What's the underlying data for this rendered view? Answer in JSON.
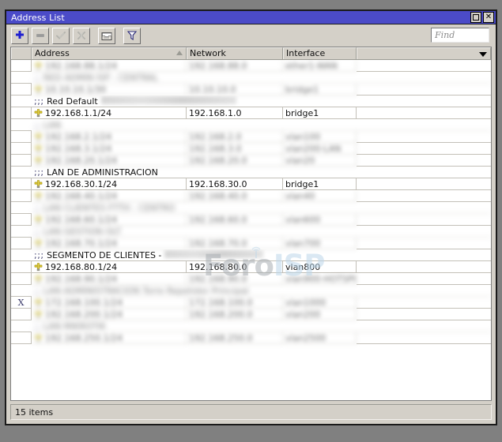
{
  "window": {
    "title": "Address List",
    "maximize_label": "□",
    "close_label": "✕"
  },
  "toolbar": {
    "buttons": [
      {
        "name": "add-button",
        "icon": "plus-icon",
        "enabled": true,
        "label": "+"
      },
      {
        "name": "remove-button",
        "icon": "minus-icon",
        "enabled": false,
        "label": "−"
      },
      {
        "name": "enable-button",
        "icon": "check-icon",
        "enabled": false,
        "label": "✓"
      },
      {
        "name": "disable-button",
        "icon": "cross-icon",
        "enabled": false,
        "label": "✗"
      },
      {
        "name": "comment-button",
        "icon": "comment-icon",
        "enabled": true,
        "label": ""
      },
      {
        "name": "filter-button",
        "icon": "funnel-icon",
        "enabled": true,
        "label": ""
      }
    ],
    "find": {
      "placeholder": "Find",
      "value": ""
    }
  },
  "table": {
    "columns": [
      {
        "key": "flag",
        "label": "",
        "sorted": false,
        "dropdown": false
      },
      {
        "key": "address",
        "label": "Address",
        "sorted": true,
        "dropdown": false
      },
      {
        "key": "network",
        "label": "Network",
        "sorted": false,
        "dropdown": false
      },
      {
        "key": "interface",
        "label": "Interface",
        "sorted": false,
        "dropdown": false
      },
      {
        "key": "rest",
        "label": "",
        "sorted": false,
        "dropdown": true
      }
    ],
    "rows": [
      {
        "type": "data",
        "flag": "",
        "address": "192.168.88.1/24",
        "network": "192.168.88.0",
        "interface": "ether1-WAN",
        "redacted": true
      },
      {
        "type": "comment",
        "flag": "",
        "comment": ";; RED ADMIN ISP - CENTRAL",
        "redacted": true
      },
      {
        "type": "data",
        "flag": "",
        "address": "10.10.10.1/30",
        "network": "10.10.10.0",
        "interface": "bridge1",
        "redacted": true
      },
      {
        "type": "comment",
        "flag": "",
        "comment": ";;; Red Default",
        "comment_tail": "ESTA ES UN IP DE BASE POR DEFECTO",
        "redacted": false
      },
      {
        "type": "data",
        "flag": "",
        "address": "192.168.1.1/24",
        "network": "192.168.1.0",
        "interface": "bridge1",
        "redacted": false
      },
      {
        "type": "comment",
        "flag": "",
        "comment": ";; LAN",
        "redacted": true
      },
      {
        "type": "data",
        "flag": "",
        "address": "192.168.2.1/24",
        "network": "192.168.2.0",
        "interface": "vlan100",
        "redacted": true
      },
      {
        "type": "data",
        "flag": "",
        "address": "192.168.3.1/24",
        "network": "192.168.3.0",
        "interface": "vlan200-LAN",
        "redacted": true
      },
      {
        "type": "data",
        "flag": "",
        "address": "192.168.20.1/24",
        "network": "192.168.20.0",
        "interface": "vlan20",
        "redacted": true
      },
      {
        "type": "comment",
        "flag": "",
        "comment": ";;; LAN DE ADMINISTRACION",
        "redacted": false
      },
      {
        "type": "data",
        "flag": "",
        "address": "192.168.30.1/24",
        "network": "192.168.30.0",
        "interface": "bridge1",
        "redacted": false
      },
      {
        "type": "data",
        "flag": "",
        "address": "192.168.40.1/24",
        "network": "192.168.40.0",
        "interface": "vlan40",
        "redacted": true
      },
      {
        "type": "comment",
        "flag": "",
        "comment": ";; LAN CLIENTES FTTH - CENTRO",
        "redacted": true
      },
      {
        "type": "data",
        "flag": "",
        "address": "192.168.60.1/24",
        "network": "192.168.60.0",
        "interface": "vlan600",
        "redacted": true
      },
      {
        "type": "comment",
        "flag": "",
        "comment": ";; LAN GESTION OLT",
        "redacted": true
      },
      {
        "type": "data",
        "flag": "",
        "address": "192.168.70.1/24",
        "network": "192.168.70.0",
        "interface": "vlan700",
        "redacted": true
      },
      {
        "type": "comment",
        "flag": "",
        "comment": ";;; SEGMENTO DE CLIENTES -",
        "comment_tail": "LAN PPPOE POOL Y PUBLICO",
        "redacted": false
      },
      {
        "type": "data",
        "flag": "",
        "address": "192.168.80.1/24",
        "network": "192.168.80.0",
        "interface": "vlan800",
        "redacted": false
      },
      {
        "type": "data",
        "flag": "",
        "address": "192.168.90.1/24",
        "network": "192.168.90.0",
        "interface": "vlan900-HOTSPOT",
        "redacted": true
      },
      {
        "type": "comment",
        "flag": "",
        "comment": ";; LAN ADMINISTRACION Torre Repetidor Principal",
        "redacted": true
      },
      {
        "type": "data",
        "flag": "X",
        "address": "172.168.100.1/24",
        "network": "172.168.100.0",
        "interface": "vlan1000",
        "redacted": true
      },
      {
        "type": "data",
        "flag": "",
        "address": "192.168.200.1/24",
        "network": "192.168.200.0",
        "interface": "vlan200",
        "redacted": true
      },
      {
        "type": "comment",
        "flag": "",
        "comment": ";; LAN MIKROTIK",
        "redacted": true
      },
      {
        "type": "data",
        "flag": "",
        "address": "192.168.250.1/24",
        "network": "192.168.250.0",
        "interface": "vlan2500",
        "redacted": true
      }
    ]
  },
  "watermark": {
    "part1": "Foro",
    "part2": "ISP"
  },
  "statusbar": {
    "items_text": "15 items"
  },
  "colors": {
    "titlebar": "#4b4bc8",
    "window_face": "#d4d0c8",
    "desktop": "#808080",
    "grid_line": "#c3c0b8",
    "pin_yellow": "#d8c32a",
    "watermark_gray": "#a9aeb3",
    "watermark_blue": "#bcd7ea"
  }
}
